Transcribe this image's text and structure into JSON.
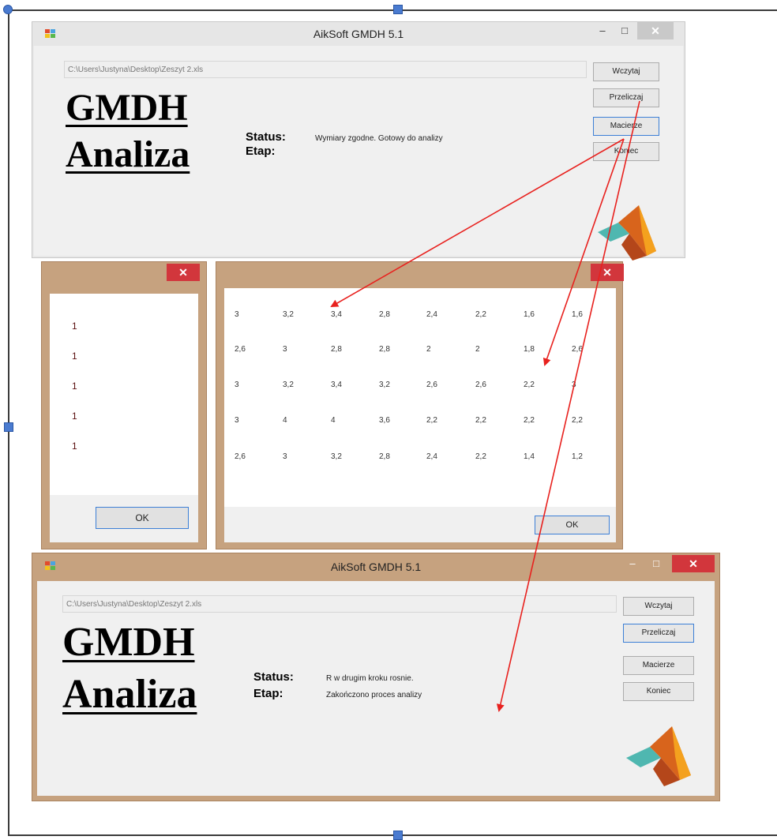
{
  "app": {
    "title": "AikSoft GMDH 5.1",
    "file_path": "C:\\Users\\Justyna\\Desktop\\Zeszyt 2.xls",
    "logo_line1": "GMDH",
    "logo_line2": "Analiza",
    "status_label": "Status:",
    "etap_label": "Etap:",
    "buttons": {
      "load": "Wczytaj",
      "compute": "Przeliczaj",
      "matrices": "Macierze",
      "exit": "Koniec"
    },
    "controls": {
      "minimize": "–",
      "maximize": "□",
      "close": "✕"
    }
  },
  "window_top": {
    "status_value": "Wymiary zgodne. Gotowy do analizy",
    "etap_value": ""
  },
  "window_bottom": {
    "status_value": "R w drugim kroku rosnie.",
    "etap_value": "Zakończono proces analizy"
  },
  "vector_dialog": {
    "close": "✕",
    "values": [
      "1",
      "1",
      "1",
      "1",
      "1"
    ],
    "ok": "OK"
  },
  "matrix_dialog": {
    "close": "✕",
    "rows": [
      [
        "3",
        "3,2",
        "3,4",
        "2,8",
        "2,4",
        "2,2",
        "1,6",
        "1,6"
      ],
      [
        "2,6",
        "3",
        "2,8",
        "2,8",
        "2",
        "2",
        "1,8",
        "2,6"
      ],
      [
        "3",
        "3,2",
        "3,4",
        "3,2",
        "2,6",
        "2,6",
        "2,2",
        "3"
      ],
      [
        "3",
        "4",
        "4",
        "3,6",
        "2,2",
        "2,2",
        "2,2",
        "2,2"
      ],
      [
        "2,6",
        "3",
        "3,2",
        "2,8",
        "2,4",
        "2,2",
        "1,4",
        "1,2"
      ]
    ],
    "ok": "OK"
  },
  "colors": {
    "dialog_frame": "#c6a27f",
    "close_red": "#d2363c",
    "arrow_red": "#e8211e"
  }
}
